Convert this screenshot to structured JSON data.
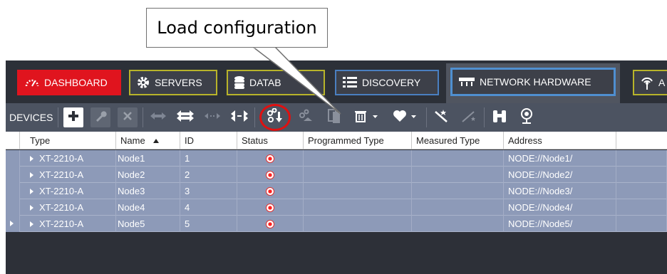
{
  "callout": {
    "text": "Load configuration"
  },
  "tabs": {
    "dashboard": "DASHBOARD",
    "servers": "SERVERS",
    "databases": "DATAB",
    "discovery": "DISCOVERY",
    "network_hardware": "NETWORK HARDWARE",
    "extra": "A"
  },
  "toolbar": {
    "label": "DEVICES",
    "icons": [
      "add-icon",
      "wrench-icon",
      "delete-icon",
      "connect-icon",
      "connect-all-icon",
      "disconnect-icon",
      "disconnect-all-icon",
      "load-configuration-icon",
      "save-configuration-icon",
      "compare-icon",
      "trash-icon",
      "heart-icon",
      "wand-icon",
      "wand-disabled-icon",
      "binoculars-icon",
      "identify-icon"
    ]
  },
  "grid": {
    "columns": [
      "Type",
      "Name",
      "ID",
      "Status",
      "Programmed Type",
      "Measured Type",
      "Address"
    ],
    "sort_column": "Name",
    "sort_direction": "ascending",
    "rows": [
      {
        "type": "XT-2210-A",
        "name": "Node1",
        "id": "1",
        "status": "error",
        "programmed_type": "",
        "measured_type": "",
        "address": "NODE://Node1/"
      },
      {
        "type": "XT-2210-A",
        "name": "Node2",
        "id": "2",
        "status": "error",
        "programmed_type": "",
        "measured_type": "",
        "address": "NODE://Node2/"
      },
      {
        "type": "XT-2210-A",
        "name": "Node3",
        "id": "3",
        "status": "error",
        "programmed_type": "",
        "measured_type": "",
        "address": "NODE://Node3/"
      },
      {
        "type": "XT-2210-A",
        "name": "Node4",
        "id": "4",
        "status": "error",
        "programmed_type": "",
        "measured_type": "",
        "address": "NODE://Node4/"
      },
      {
        "type": "XT-2210-A",
        "name": "Node5",
        "id": "5",
        "status": "error",
        "programmed_type": "",
        "measured_type": "",
        "address": "NODE://Node5/"
      }
    ]
  },
  "colors": {
    "dashboard_tab": "#e0141e",
    "tab_border": "#b8b42a",
    "active_tab_border": "#4f8fd0",
    "row_background": "#8d9ab8",
    "status_error": "#ff2020",
    "highlight_circle": "#e01010"
  }
}
